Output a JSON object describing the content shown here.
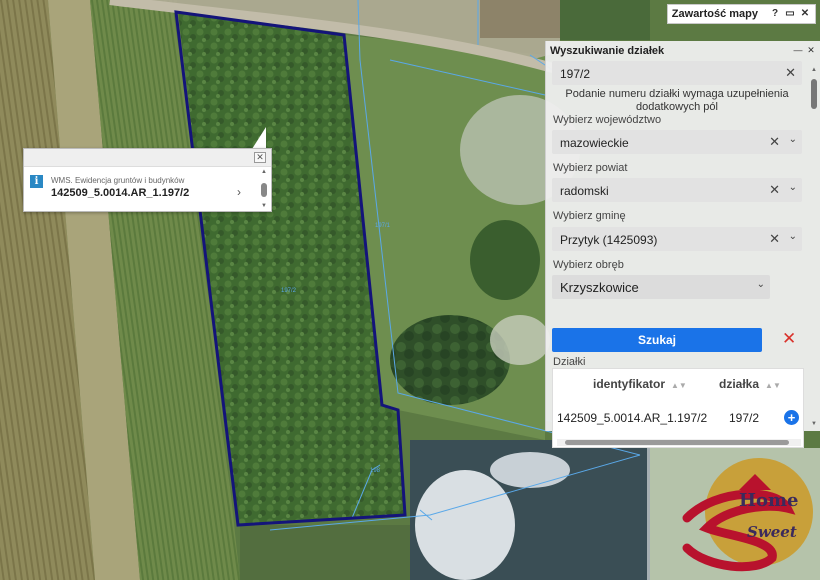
{
  "map": {
    "parcel_labels": [
      "197/2",
      "197/1",
      "198"
    ],
    "colors": {
      "parcel_outline": "#14147a",
      "cadastral_lines": "#5aa8e8"
    }
  },
  "toolbar": {
    "title": "Zawartość mapy",
    "buttons": [
      "help-icon",
      "maximize-icon",
      "close-icon"
    ]
  },
  "popup": {
    "source": "WMS. Ewidencja gruntów i budynków",
    "identifier": "142509_5.0014.AR_1.197/2"
  },
  "panel": {
    "title": "Wyszukiwanie działek",
    "search_value": "197/2",
    "hint": "Podanie numeru działki wymaga uzupełnienia dodatkowych pól",
    "labels": {
      "voivodeship": "Wybierz województwo",
      "county": "Wybierz powiat",
      "commune": "Wybierz gminę",
      "precinct": "Wybierz obręb",
      "results": "Działki"
    },
    "voivodeship": "mazowieckie",
    "county": "radomski",
    "commune": "Przytyk (1425093)",
    "precinct": "Krzyszkowice",
    "search_button": "Szukaj",
    "table": {
      "columns": [
        "identyfikator",
        "działka"
      ],
      "rows": [
        [
          "142509_5.0014.AR_1.197/2",
          "197/2"
        ]
      ]
    }
  },
  "logo": {
    "line1": "Home",
    "line2": "Sweet",
    "accent": "#c8a03a",
    "primary": "#3b2a5c",
    "red": "#b8122d"
  }
}
